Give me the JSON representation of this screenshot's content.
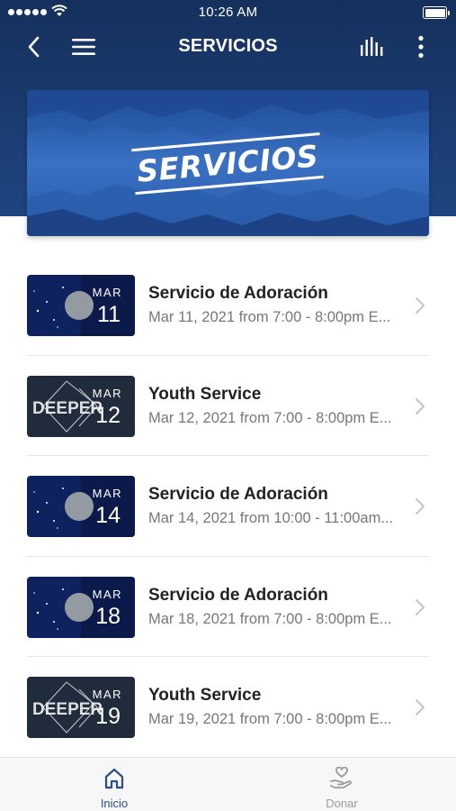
{
  "status_bar": {
    "time": "10:26 AM"
  },
  "nav": {
    "title": "SERVICIOS"
  },
  "banner": {
    "text": "SERVICIOS"
  },
  "events": [
    {
      "month": "MAR",
      "day": "11",
      "title": "Servicio de Adoración",
      "subtitle": "Mar 11, 2021 from 7:00 - 8:00pm E...",
      "thumb": "adoracion"
    },
    {
      "month": "MAR",
      "day": "12",
      "title": "Youth Service",
      "subtitle": "Mar 12, 2021 from 7:00 - 8:00pm E...",
      "thumb": "deeper"
    },
    {
      "month": "MAR",
      "day": "14",
      "title": "Servicio de Adoración",
      "subtitle": "Mar 14, 2021 from 10:00 - 11:00am...",
      "thumb": "adoracion"
    },
    {
      "month": "MAR",
      "day": "18",
      "title": "Servicio de Adoración",
      "subtitle": "Mar 18, 2021 from 7:00 - 8:00pm E...",
      "thumb": "adoracion"
    },
    {
      "month": "MAR",
      "day": "19",
      "title": "Youth Service",
      "subtitle": "Mar 19, 2021 from 7:00 - 8:00pm E...",
      "thumb": "deeper"
    }
  ],
  "tabbar": {
    "tabs": [
      {
        "label": "Inicio",
        "icon": "home-icon",
        "active": true
      },
      {
        "label": "Donar",
        "icon": "donate-hand-heart-icon",
        "active": false
      }
    ]
  },
  "colors": {
    "header": "#1b3d72",
    "active_tab": "#2a4f8a",
    "inactive_tab": "#9a9a9a"
  }
}
